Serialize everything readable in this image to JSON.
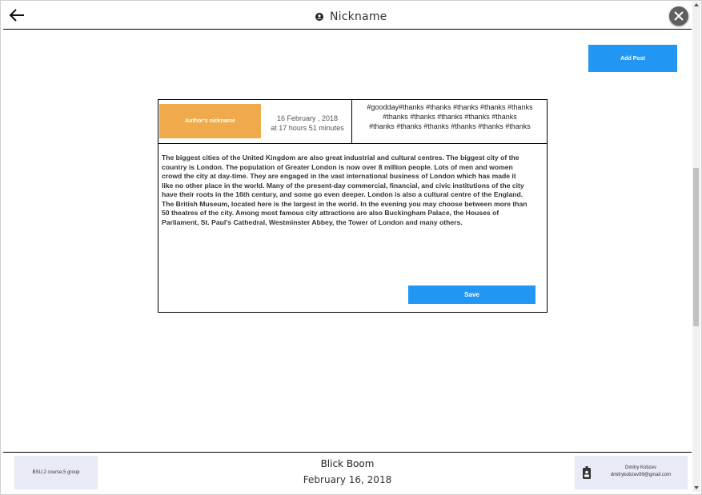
{
  "header": {
    "title": "Nickname",
    "back_icon": "arrow-left-icon",
    "title_icon": "account-circle-icon",
    "close_icon": "close-icon"
  },
  "actions": {
    "add_post_label": "Add Post"
  },
  "post": {
    "author_label": "Author's  nickname",
    "date_line1": "16 February , 2018",
    "date_line2": "at 17 hours 51 minutes",
    "tags_line1": "#goodday#thanks  #thanks  #thanks  #thanks  #thanks",
    "tags_line2": "#thanks  #thanks  #thanks  #thanks  #thanks",
    "tags_line3": "#thanks  #thanks  #thanks  #thanks  #thanks  #thanks",
    "text": " The biggest cities of the United Kingdom are also great industrial and cultural centres. The biggest city of the country is London. The population of Greater London is now over 8 million people. Lots of men and women crowd the city at day-time. They are engaged in the vast international business of London which has made it like no other place in the world. Many of the present-day commercial, financial, and civic institutions of the city have their roots in the 16th century, and some go even deeper. London is also a cultural centre of the England. The British Museum, located here is the largest in the world. In the evening you may choose between more than 50 theatres of the city. Among most famous city attractions are also Buckingham Palace, the Houses of Parliament, St. Paul's Cathedral, Westminster Abbey, the Tower of London and many others.",
    "save_label": "Save"
  },
  "footer": {
    "group_label": "BSU,2 course,5 group",
    "brand": "Blick Boom",
    "date": "February 16, 2018",
    "author_name": "Dmitry Kobzev",
    "author_email": "dmitrykobzev99@gmail.com",
    "author_icon": "id-badge-icon"
  },
  "colors": {
    "accent_blue": "#2196f3",
    "author_orange": "#efab4b",
    "footer_box": "#e8eaf6",
    "close_button": "#5f5f5f"
  }
}
